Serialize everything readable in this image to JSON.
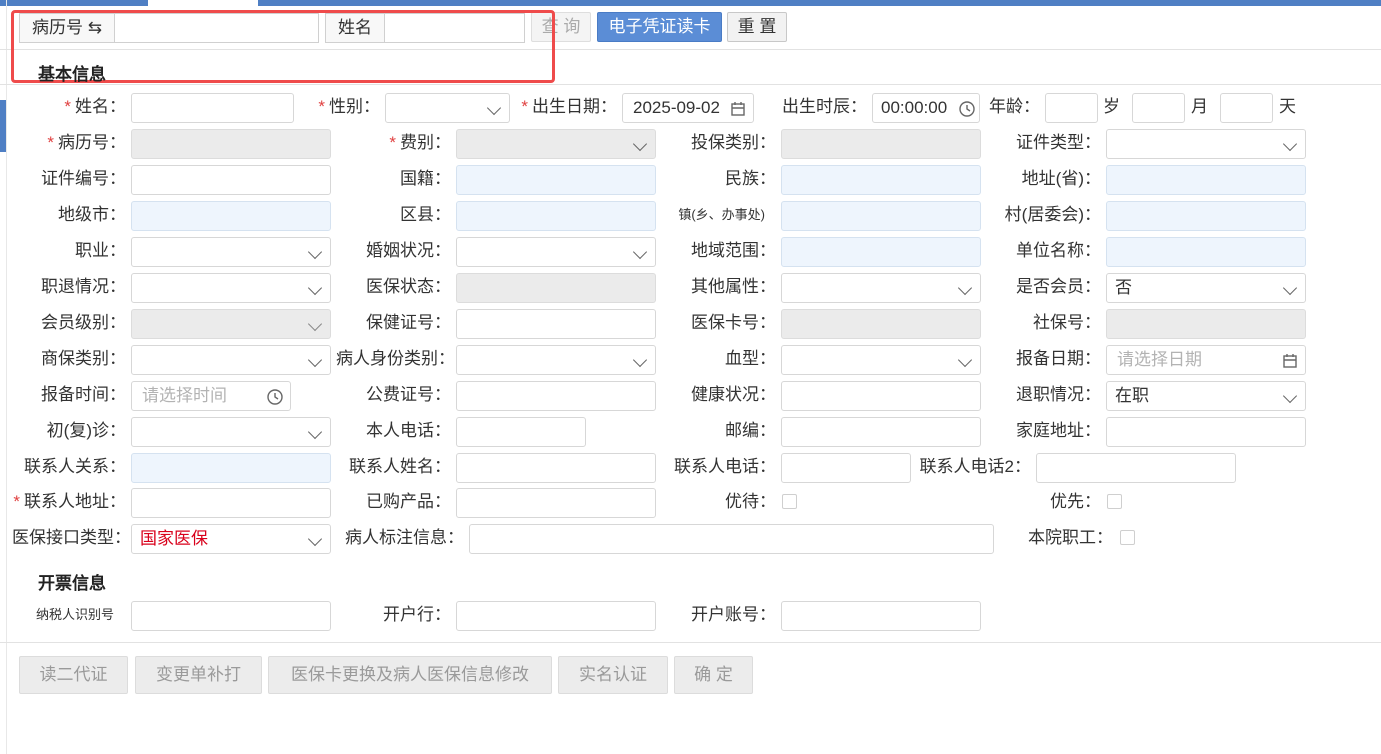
{
  "toolbar": {
    "search_caption": "病历号 ⇆",
    "name_caption": "姓名",
    "query_label": "查 询",
    "card_label": "电子凭证读卡",
    "reset_label": "重 置"
  },
  "sections": {
    "basic": "基本信息",
    "invoice": "开票信息"
  },
  "fields": {
    "name": "姓名：",
    "gender": "性别：",
    "birthdate": "出生日期：",
    "birthdate_value": "2025-09-02",
    "birthtime": "出生时辰：",
    "birthtime_value": "00:00:00",
    "age": "年龄：",
    "age_year": "岁",
    "age_month": "月",
    "age_day": "天",
    "record_no": "病历号：",
    "fee_type": "费别：",
    "insure_type": "投保类别：",
    "id_type": "证件类型：",
    "id_no": "证件编号：",
    "nationality": "国籍：",
    "ethnic": "民族：",
    "province": "地址(省)：",
    "city": "地级市：",
    "county": "区县：",
    "town": "镇(乡、办事处)",
    "village": "村(居委会)：",
    "job": "职业：",
    "marriage": "婚姻状况：",
    "region": "地域范围：",
    "company": "单位名称：",
    "retire_info": "职退情况：",
    "insure_status": "医保状态：",
    "other_attr": "其他属性：",
    "is_member": "是否会员：",
    "is_member_value": "否",
    "member_level": "会员级别：",
    "health_card": "保健证号：",
    "insure_card": "医保卡号：",
    "social_no": "社保号：",
    "commercial": "商保类别：",
    "patient_type": "病人身份类别：",
    "blood": "血型：",
    "report_date": "报备日期：",
    "report_date_ph": "请选择日期",
    "report_time": "报备时间：",
    "report_time_ph": "请选择时间",
    "public_fee": "公费证号：",
    "health": "健康状况：",
    "retire": "退职情况：",
    "retire_value": "在职",
    "visit": "初(复)诊：",
    "phone": "本人电话：",
    "zip": "邮编：",
    "home_addr": "家庭地址：",
    "contact_rel": "联系人关系：",
    "contact_name": "联系人姓名：",
    "contact_phone": "联系人电话：",
    "contact_phone2": "联系人电话2：",
    "contact_addr": "联系人地址：",
    "bought": "已购产品：",
    "vip": "优待：",
    "priority": "优先：",
    "insure_iface": "医保接口类型：",
    "insure_iface_value": "国家医保",
    "patient_mark": "病人标注信息：",
    "staff": "本院职工：",
    "taxpayer": "纳税人识别号",
    "bank": "开户行：",
    "account": "开户账号："
  },
  "footer": {
    "read_id": "读二代证",
    "reprint": "变更单补打",
    "change_card": "医保卡更换及病人医保信息修改",
    "realname": "实名认证",
    "confirm": "确 定"
  }
}
